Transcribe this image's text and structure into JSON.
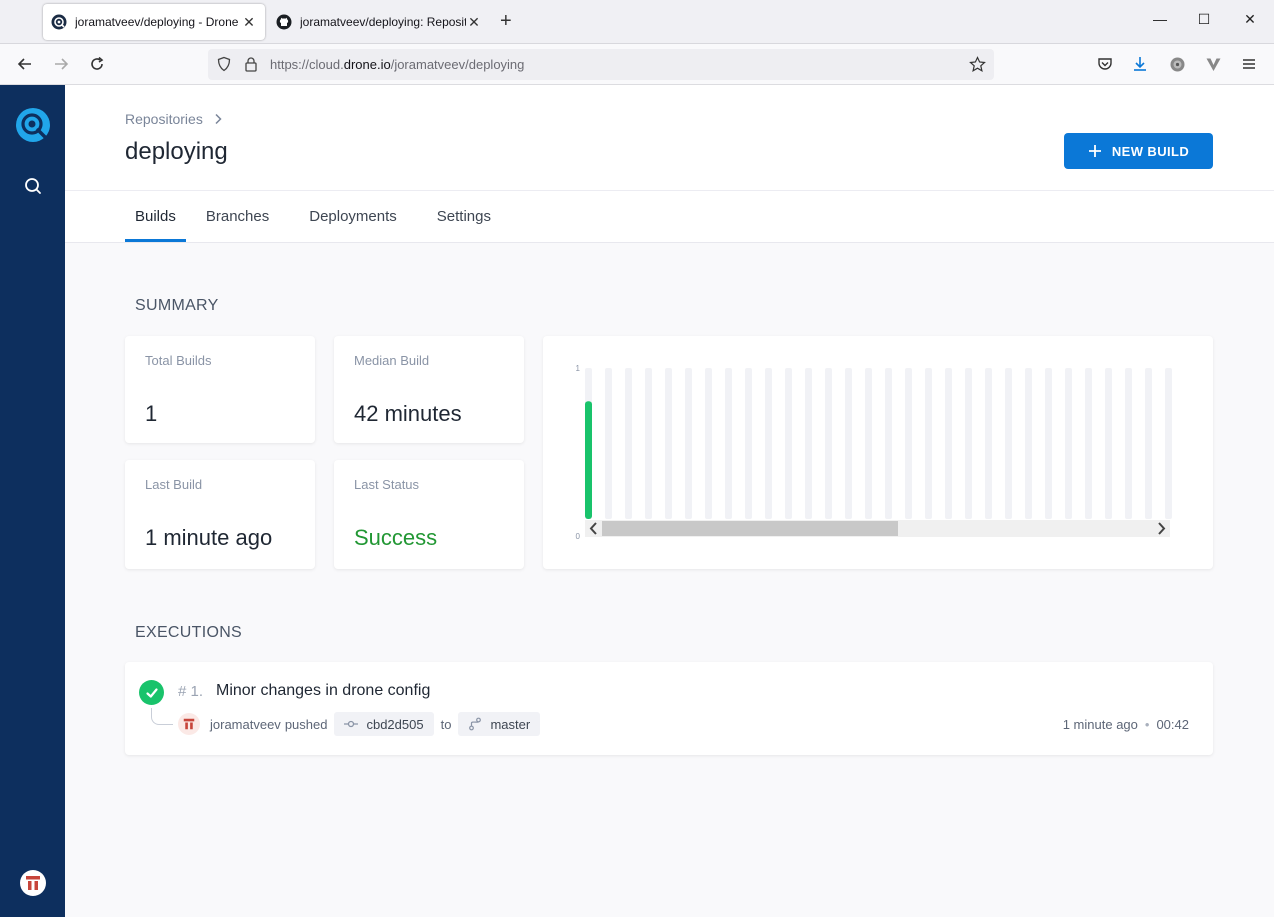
{
  "browser": {
    "tabs": [
      {
        "title": "joramatveev/deploying - Drone",
        "active": true
      },
      {
        "title": "joramatveev/deploying: Repository",
        "active": false
      }
    ],
    "url_prefix": "https://cloud.",
    "url_domain": "drone.io",
    "url_path": "/joramatveev/deploying"
  },
  "sidebar": {
    "logo": "drone-logo-icon",
    "search_icon": "search-icon",
    "avatar": "user-avatar-icon"
  },
  "header": {
    "breadcrumb": "Repositories",
    "title": "deploying",
    "new_build_label": "NEW BUILD",
    "tabs": [
      {
        "label": "Builds",
        "active": true
      },
      {
        "label": "Branches",
        "active": false
      },
      {
        "label": "Deployments",
        "active": false
      },
      {
        "label": "Settings",
        "active": false
      }
    ]
  },
  "summary": {
    "heading": "SUMMARY",
    "total_builds_label": "Total Builds",
    "total_builds_value": "1",
    "median_build_label": "Median Build",
    "median_build_value": "42 minutes",
    "last_build_label": "Last Build",
    "last_build_value": "1 minute ago",
    "last_status_label": "Last Status",
    "last_status_value": "Success",
    "success_color": "#229734"
  },
  "chart_data": {
    "type": "bar",
    "title": "",
    "xlabel": "",
    "ylabel": "",
    "ylim": [
      0,
      1
    ],
    "yticks": [
      "0",
      "1"
    ],
    "slots": 30,
    "values": [
      0.78
    ],
    "bar_color": "#19c36b",
    "track_color": "#f1f2f6",
    "scrollbar": true
  },
  "executions": {
    "heading": "EXECUTIONS",
    "items": [
      {
        "number": "# 1.",
        "message": "Minor changes in drone config",
        "status": "success",
        "author": "joramatveev",
        "action": "pushed",
        "commit": "cbd2d505",
        "to_word": "to",
        "branch": "master",
        "time_ago": "1 minute ago",
        "duration": "00:42"
      }
    ]
  }
}
